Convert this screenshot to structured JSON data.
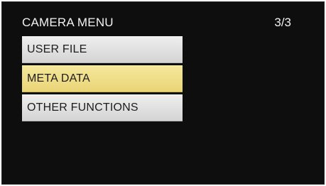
{
  "header": {
    "title": "CAMERA MENU",
    "page_indicator": "3/3"
  },
  "menu": {
    "items": [
      {
        "label": "USER FILE",
        "selected": false
      },
      {
        "label": "META DATA",
        "selected": true
      },
      {
        "label": "OTHER FUNCTIONS",
        "selected": false
      }
    ]
  },
  "colors": {
    "background": "#0e0e0e",
    "item_background": "#e2e2e2",
    "selected_background": "#efdf88",
    "header_text": "#f2f2f2"
  }
}
